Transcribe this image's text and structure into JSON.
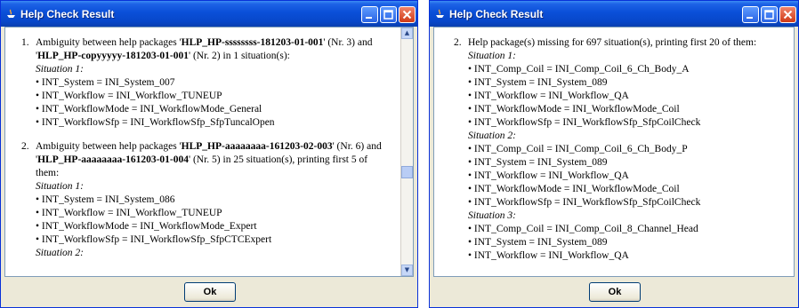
{
  "dialog": {
    "title": "Help Check Result",
    "ok_label": "Ok"
  },
  "left": {
    "items": [
      {
        "num": "1.",
        "parts": [
          "Ambiguity between help packages '",
          "HLP_HP-ssssssss-181203-01-001",
          "' (Nr. 3) and '",
          "HLP_HP-copyyyyy-181203-01-001",
          "' (Nr. 2) in 1 situation(s):"
        ],
        "situations": [
          {
            "label": "Situation 1:",
            "lines": [
              "INT_System = INI_System_007",
              "INT_Workflow = INI_Workflow_TUNEUP",
              "INT_WorkflowMode = INI_WorkflowMode_General",
              "INT_WorkflowSfp = INI_WorkflowSfp_SfpTuncalOpen"
            ]
          }
        ]
      },
      {
        "num": "2.",
        "parts": [
          "Ambiguity between help packages '",
          "HLP_HP-aaaaaaaa-161203-02-003",
          "' (Nr. 6) and '",
          "HLP_HP-aaaaaaaa-161203-01-004",
          "' (Nr. 5) in 25 situation(s), printing first 5 of them:"
        ],
        "situations": [
          {
            "label": "Situation 1:",
            "lines": [
              "INT_System = INI_System_086",
              "INT_Workflow = INI_Workflow_TUNEUP",
              "INT_WorkflowMode = INI_WorkflowMode_Expert",
              "INT_WorkflowSfp = INI_WorkflowSfp_SfpCTCExpert"
            ]
          },
          {
            "label": "Situation 2:",
            "lines": []
          }
        ]
      }
    ]
  },
  "right": {
    "items": [
      {
        "num": "2.",
        "intro": "Help package(s) missing for 697 situation(s), printing first 20 of them:",
        "situations": [
          {
            "label": "Situation 1:",
            "lines": [
              "INT_Comp_Coil = INI_Comp_Coil_6_Ch_Body_A",
              "INT_System = INI_System_089",
              "INT_Workflow = INI_Workflow_QA",
              "INT_WorkflowMode = INI_WorkflowMode_Coil",
              "INT_WorkflowSfp = INI_WorkflowSfp_SfpCoilCheck"
            ]
          },
          {
            "label": "Situation 2:",
            "lines": [
              "INT_Comp_Coil = INI_Comp_Coil_6_Ch_Body_P",
              "INT_System = INI_System_089",
              "INT_Workflow = INI_Workflow_QA",
              "INT_WorkflowMode = INI_WorkflowMode_Coil",
              "INT_WorkflowSfp = INI_WorkflowSfp_SfpCoilCheck"
            ]
          },
          {
            "label": "Situation 3:",
            "lines": [
              "INT_Comp_Coil = INI_Comp_Coil_8_Channel_Head",
              "INT_System = INI_System_089",
              "INT_Workflow = INI_Workflow_QA"
            ]
          }
        ]
      }
    ]
  },
  "colors": {
    "titlebar": "#0a4fd8",
    "window_bg": "#ece9d8",
    "close_button": "#d9411e"
  },
  "icons": {
    "title_icon": "java-icon",
    "minimize": "minimize-icon",
    "maximize": "maximize-icon",
    "close": "close-icon"
  }
}
